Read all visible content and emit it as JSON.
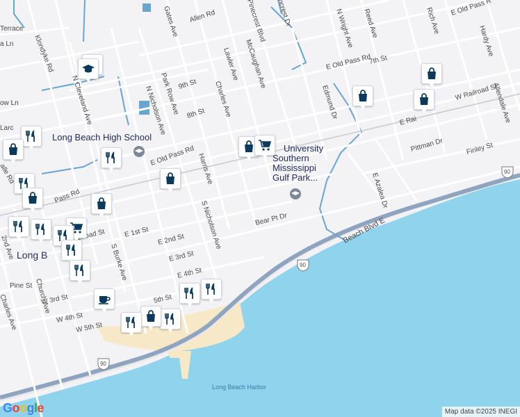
{
  "map": {
    "attribution": "Map data ©2025 INEGI",
    "logo": "Google",
    "colors": {
      "land": "#f3f2f4",
      "water": "#8fd3ec",
      "beach": "#f7e9c8",
      "highway": "#8ea4bf",
      "road": "#ffffff",
      "poi_blue": "#6aa5cf",
      "marker_fill": "#0b3a5c"
    }
  },
  "roads": [
    {
      "name": "Terrace"
    },
    {
      "name": "Klondyke Rd"
    },
    {
      "name": "a Ln"
    },
    {
      "name": "ow Ln"
    },
    {
      "name": "Larc"
    },
    {
      "name": "alle Rd"
    },
    {
      "name": "Pass Rd"
    },
    {
      "name": "2nd Ave"
    },
    {
      "name": "Pine St"
    },
    {
      "name": "Church Ave"
    },
    {
      "name": "Charles Ave"
    },
    {
      "name": "W 3rd St"
    },
    {
      "name": "W 4th St"
    },
    {
      "name": "W 5th St"
    },
    {
      "name": "ailroad St"
    },
    {
      "name": "E 1st St"
    },
    {
      "name": "E 2nd St"
    },
    {
      "name": "E 3rd St"
    },
    {
      "name": "E 4th St"
    },
    {
      "name": "5th St"
    },
    {
      "name": "S Burke Ave"
    },
    {
      "name": "N Cleveland Ave"
    },
    {
      "name": "N Nicholson Ave"
    },
    {
      "name": "S Nicholson Ave"
    },
    {
      "name": "Park Row Ave"
    },
    {
      "name": "Gates Ave"
    },
    {
      "name": "Allen Rd"
    },
    {
      "name": "9th St"
    },
    {
      "name": "8th St"
    },
    {
      "name": "Charles Ave"
    },
    {
      "name": "Lawler Ave"
    },
    {
      "name": "McCaughan Ave"
    },
    {
      "name": "Pinecrest Blvd"
    },
    {
      "name": "ncrest Dr"
    },
    {
      "name": "N Wright Ave"
    },
    {
      "name": "Reed Ave"
    },
    {
      "name": "Rich Ave"
    },
    {
      "name": "E Old Pass R"
    },
    {
      "name": "Hardy Ave"
    },
    {
      "name": "E Old Pass Rd"
    },
    {
      "name": "7th St"
    },
    {
      "name": "Edmund Dr"
    },
    {
      "name": "W Railroad St"
    },
    {
      "name": "E Rai"
    },
    {
      "name": "Pittman Dr"
    },
    {
      "name": "Allendale Ave"
    },
    {
      "name": "Finley St"
    },
    {
      "name": "Harris Ave"
    },
    {
      "name": "E Old Pass Rd"
    },
    {
      "name": "E Azalea Dr"
    },
    {
      "name": "Bear Pt Dr"
    },
    {
      "name": "Beach Blvd E"
    },
    {
      "name": "90"
    },
    {
      "name": "90"
    },
    {
      "name": "90"
    }
  ],
  "places": {
    "university": "University Southern Mississippi Gulf Park...",
    "high_school": "Long Beach High School",
    "city": "Long B",
    "harbor": "Long Beach Harbor"
  },
  "markers": [
    {
      "type": "school",
      "icon": "graduation-cap-icon"
    },
    {
      "type": "school",
      "icon": "graduation-cap-icon"
    },
    {
      "type": "shopping",
      "icon": "shopping-bag-icon"
    },
    {
      "type": "shopping",
      "icon": "shopping-bag-icon"
    },
    {
      "type": "shopping",
      "icon": "shopping-bag-icon"
    },
    {
      "type": "shopping",
      "icon": "shopping-bag-icon"
    },
    {
      "type": "grocery",
      "icon": "shopping-cart-icon"
    },
    {
      "type": "shopping",
      "icon": "shopping-bag-icon"
    },
    {
      "type": "restaurant",
      "icon": "fork-knife-icon"
    },
    {
      "type": "restaurant",
      "icon": "fork-knife-icon"
    },
    {
      "type": "shopping",
      "icon": "shopping-bag-icon"
    },
    {
      "type": "restaurant",
      "icon": "fork-knife-icon"
    },
    {
      "type": "shopping",
      "icon": "shopping-bag-icon"
    },
    {
      "type": "shopping",
      "icon": "shopping-bag-icon"
    },
    {
      "type": "grocery",
      "icon": "shopping-cart-icon"
    },
    {
      "type": "restaurant",
      "icon": "fork-knife-icon"
    },
    {
      "type": "restaurant",
      "icon": "fork-knife-icon"
    },
    {
      "type": "restaurant",
      "icon": "fork-knife-icon"
    },
    {
      "type": "restaurant",
      "icon": "fork-knife-icon"
    },
    {
      "type": "cafe",
      "icon": "coffee-cup-icon"
    },
    {
      "type": "restaurant",
      "icon": "fork-knife-icon"
    },
    {
      "type": "restaurant",
      "icon": "fork-knife-icon"
    },
    {
      "type": "restaurant",
      "icon": "fork-knife-icon"
    },
    {
      "type": "restaurant",
      "icon": "fork-knife-icon"
    },
    {
      "type": "shopping",
      "icon": "shopping-bag-icon"
    },
    {
      "type": "restaurant",
      "icon": "fork-knife-icon"
    }
  ]
}
